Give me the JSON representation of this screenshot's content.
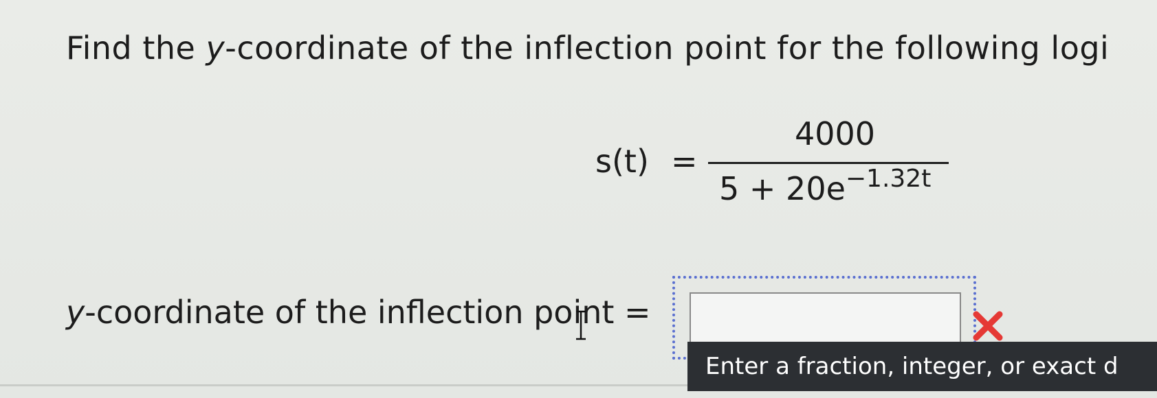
{
  "question": {
    "prefix": "Find the ",
    "variable": "y",
    "suffix": "-coordinate of the inflection point for the following logi"
  },
  "equation": {
    "lhs": "s(t)",
    "equals": "=",
    "numerator": "4000",
    "denominator_base": "5 + 20e",
    "denominator_exponent": "−1.32t"
  },
  "answer": {
    "label_variable": "y",
    "label_text": "-coordinate of the inflection point =",
    "input_value": "",
    "status": "incorrect",
    "error_color": "#e53935"
  },
  "tooltip": {
    "text": "Enter a fraction, integer, or exact d"
  },
  "colors": {
    "focus_border": "#5a6fd0",
    "tooltip_bg": "#2c2f33"
  }
}
